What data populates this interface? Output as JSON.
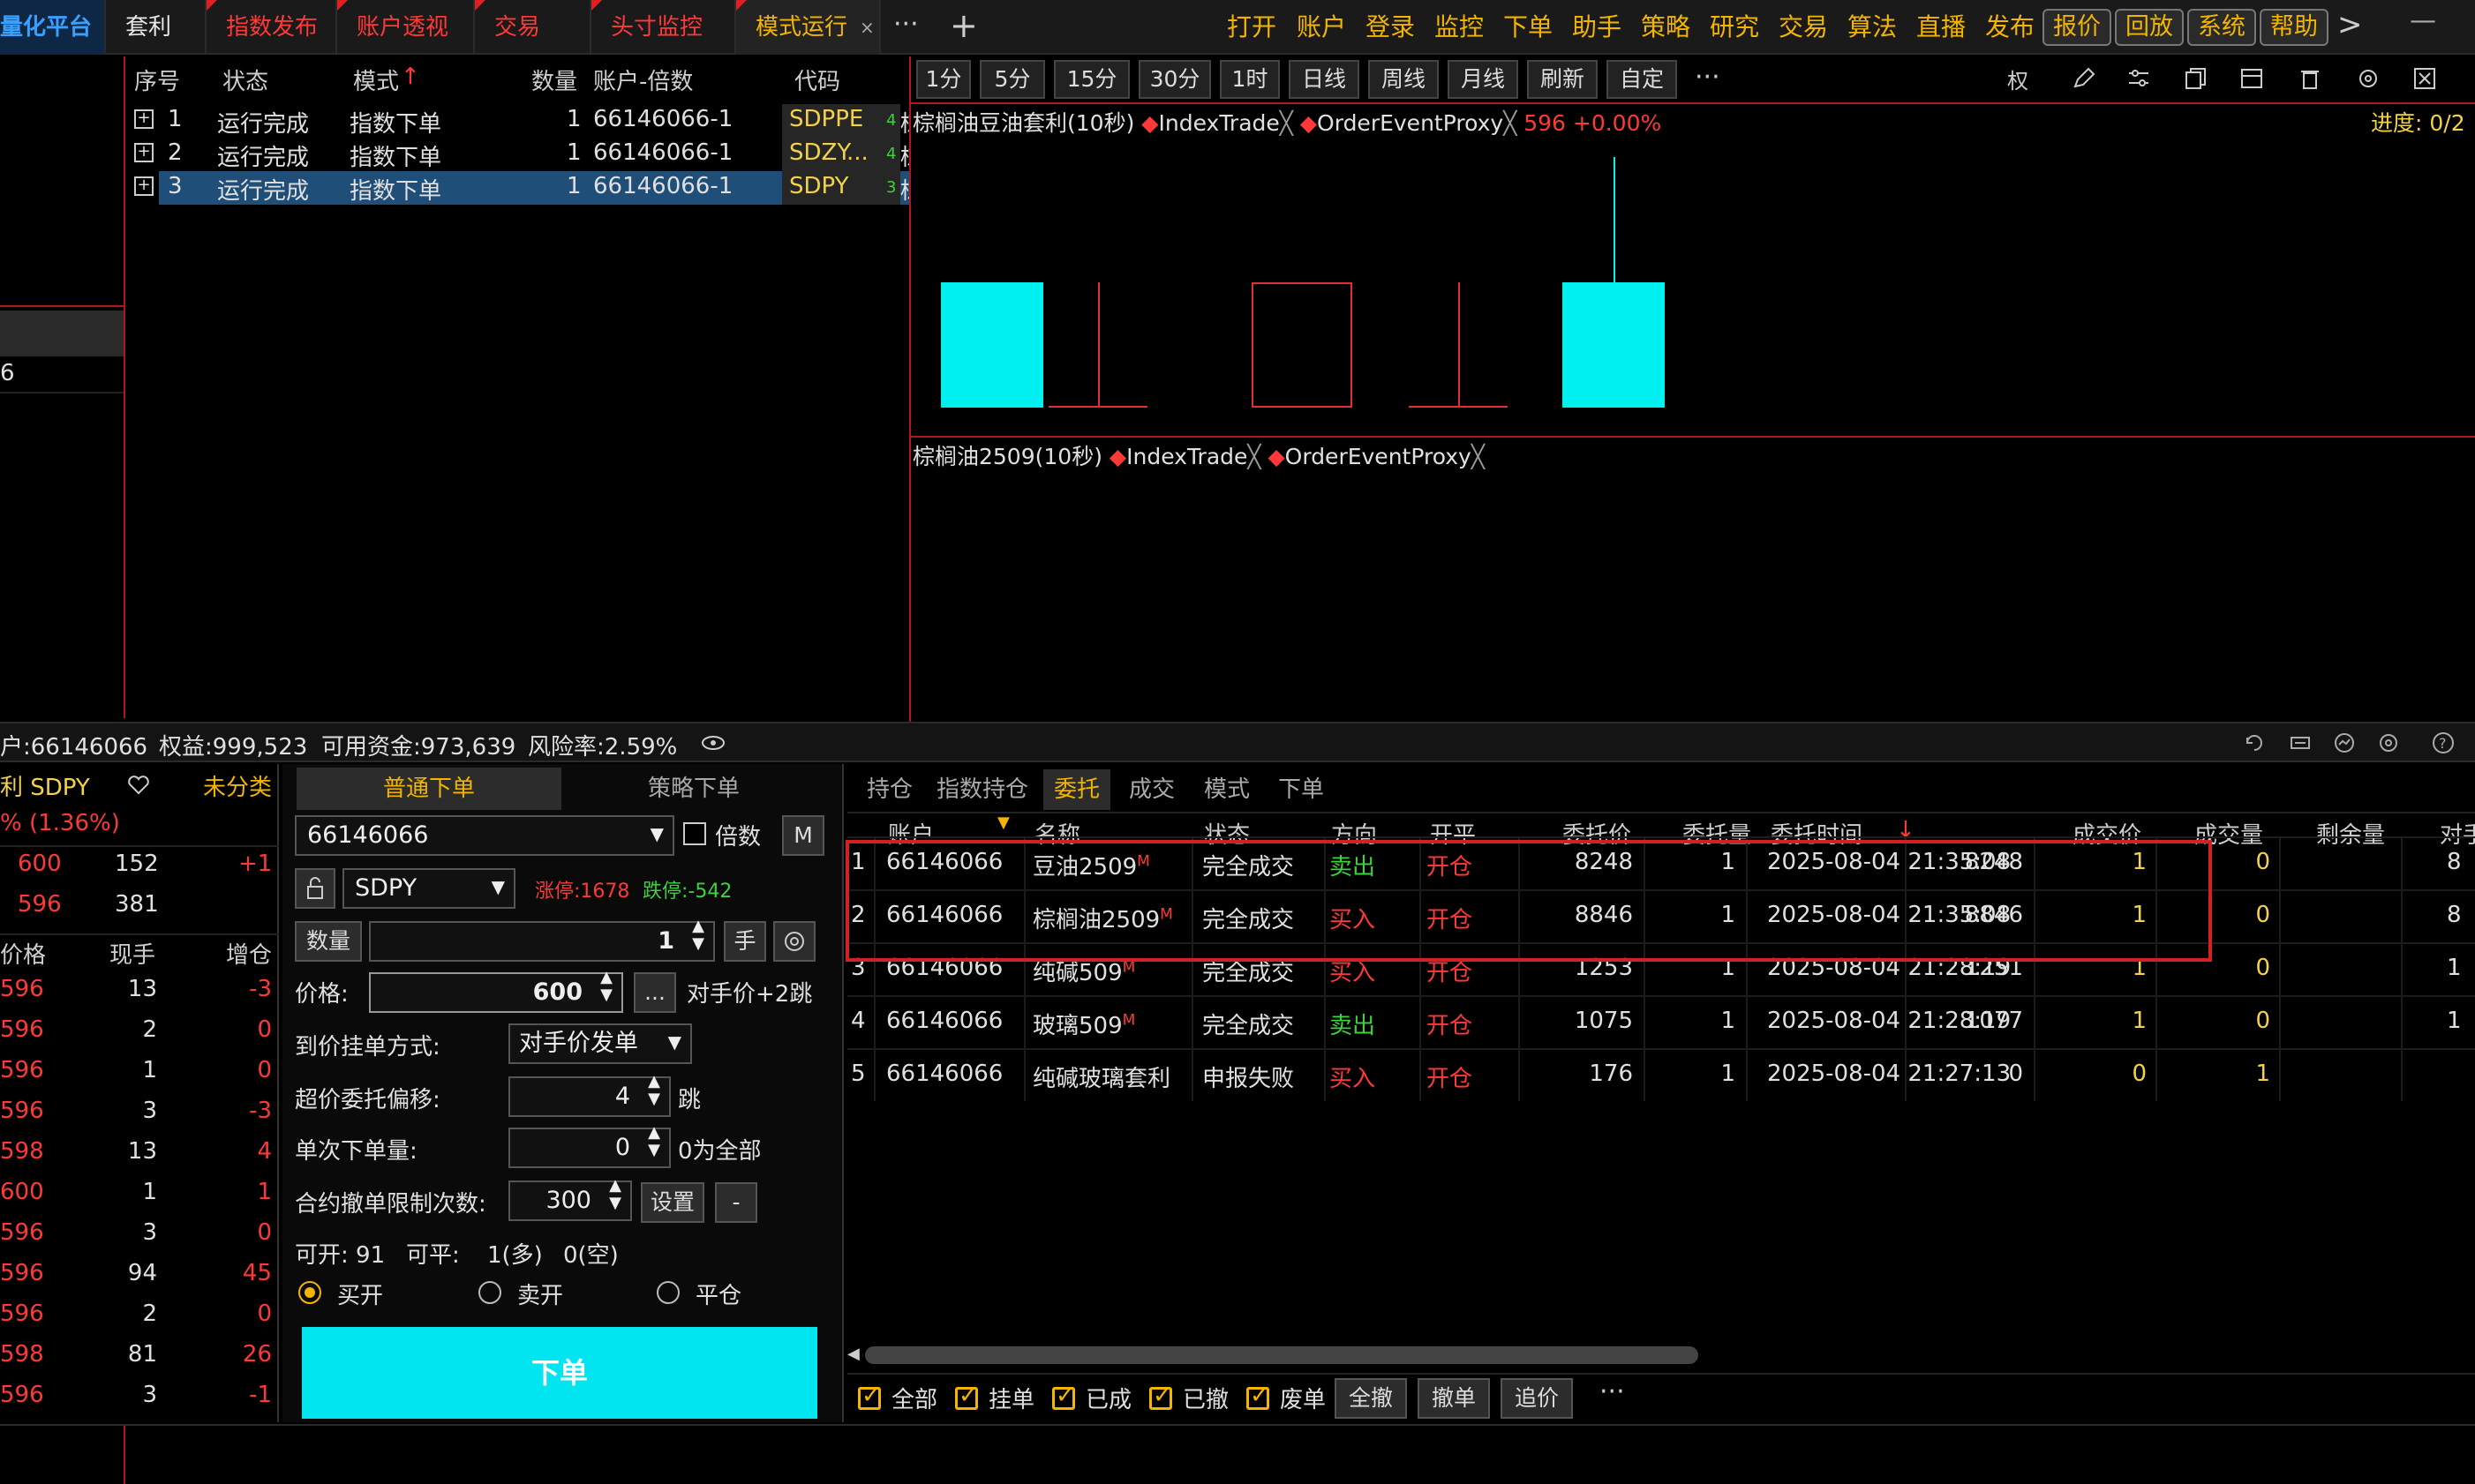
{
  "tabs": [
    {
      "label": "量化平台"
    },
    {
      "label": "套利"
    },
    {
      "label": "指数发布"
    },
    {
      "label": "账户透视"
    },
    {
      "label": "交易"
    },
    {
      "label": "头寸监控"
    },
    {
      "label": "模式运行"
    }
  ],
  "tab_more": "···",
  "tab_add": "+",
  "tab_close": "×",
  "menu": [
    "打开",
    "账户",
    "登录",
    "监控",
    "下单",
    "助手",
    "策略",
    "研究",
    "交易",
    "算法",
    "直播",
    "发布"
  ],
  "menu_buttons": [
    "报价",
    "回放",
    "系统",
    "帮助"
  ],
  "window_min": "—",
  "menu_more": ">",
  "mode_table": {
    "headers": [
      "序号",
      "状态",
      "模式",
      "数量",
      "账户-倍数",
      "代码"
    ],
    "rows": [
      {
        "no": "1",
        "status": "运行完成",
        "mode": "指数下单",
        "qty": "1",
        "acct": "66146066-1",
        "code": "SDPPE",
        "extra": "4",
        "tail": "棕"
      },
      {
        "no": "2",
        "status": "运行完成",
        "mode": "指数下单",
        "qty": "1",
        "acct": "66146066-1",
        "code": "SDZY...",
        "extra": "4",
        "tail": "棕"
      },
      {
        "no": "3",
        "status": "运行完成",
        "mode": "指数下单",
        "qty": "1",
        "acct": "66146066-1",
        "code": "SDPY",
        "extra": "3",
        "tail": "棕"
      }
    ]
  },
  "left_stub": {
    "num": "6"
  },
  "chart_toolbar": [
    "1分",
    "5分",
    "15分",
    "30分",
    "1时",
    "日线",
    "周线",
    "月线",
    "刷新",
    "自定"
  ],
  "chart_toolbar_more": "···",
  "chart_toolbar_icons": {
    "quan": "权"
  },
  "chart1": {
    "title": "棕榈油豆油套利(10秒)",
    "ind1": "IndexTrade",
    "ind2": "OrderEventProxy",
    "value": "596 +0.00%",
    "progress": "进度: 0/2"
  },
  "chart2": {
    "title": "棕榈油2509(10秒)",
    "ind1": "IndexTrade",
    "ind2": "OrderEventProxy"
  },
  "status_bar": {
    "account": "户:66146066",
    "equity": "权益:999,523",
    "available": "可用资金:973,639",
    "risk": "风险率:2.59%"
  },
  "quote_panel": {
    "title": "利 SDPY",
    "category": "未分类",
    "change": "% (1.36%)",
    "bid_rows": [
      {
        "p": "600",
        "v": "152",
        "d": "+1"
      },
      {
        "p": "596",
        "v": "381",
        "d": ""
      }
    ],
    "headers": [
      "价格",
      "现手",
      "增仓"
    ],
    "ticks": [
      {
        "p": "596",
        "v": "13",
        "d": "-3"
      },
      {
        "p": "596",
        "v": "2",
        "d": "0"
      },
      {
        "p": "596",
        "v": "1",
        "d": "0"
      },
      {
        "p": "596",
        "v": "3",
        "d": "-3"
      },
      {
        "p": "598",
        "v": "13",
        "d": "4"
      },
      {
        "p": "600",
        "v": "1",
        "d": "1"
      },
      {
        "p": "596",
        "v": "3",
        "d": "0"
      },
      {
        "p": "596",
        "v": "94",
        "d": "45"
      },
      {
        "p": "596",
        "v": "2",
        "d": "0"
      },
      {
        "p": "598",
        "v": "81",
        "d": "26"
      },
      {
        "p": "596",
        "v": "3",
        "d": "-1"
      }
    ]
  },
  "order_form": {
    "tab_normal": "普通下单",
    "tab_strategy": "策略下单",
    "account": "66146066",
    "multiple_label": "倍数",
    "m_button": "M",
    "symbol": "SDPY",
    "limit_up": "涨停:1678",
    "limit_down": "跌停:-542",
    "qty_button": "数量",
    "qty": "1",
    "hand": "手",
    "price_label": "价格:",
    "price": "600",
    "price_more": "...",
    "price_desc": "对手价+2跳",
    "pending_label": "到价挂单方式:",
    "pending_value": "对手价发单",
    "offset_label": "超价委托偏移:",
    "offset_value": "4",
    "offset_unit": "跳",
    "single_label": "单次下单量:",
    "single_value": "0",
    "single_unit": "0为全部",
    "cancel_label": "合约撤单限制次数:",
    "cancel_value": "300",
    "set_button": "设置",
    "minus_button": "-",
    "open_avail": "可开:  91",
    "close_avail": "可平:",
    "close_long": "1(多)",
    "close_short": "0(空)",
    "radio_buy": "买开",
    "radio_sell": "卖开",
    "radio_close": "平仓",
    "submit": "下单"
  },
  "orders": {
    "tabs": [
      "持仓",
      "指数持仓",
      "委托",
      "成交",
      "模式",
      "下单"
    ],
    "headers": [
      "账户",
      "名称",
      "状态",
      "方向",
      "开平",
      "委托价",
      "委托量",
      "委托时间",
      "成交价",
      "成交量",
      "剩余量",
      "对手"
    ],
    "rows": [
      {
        "no": "1",
        "acct": "66146066",
        "name": "豆油2509",
        "m": "M",
        "status": "完全成交",
        "dir": "卖出",
        "oc": "开仓",
        "price": "8248",
        "qty": "1",
        "time": "2025-08-04 21:35:08",
        "fill": "8248",
        "fqty": "1",
        "rem": "0",
        "x": "8"
      },
      {
        "no": "2",
        "acct": "66146066",
        "name": "棕榈油2509",
        "m": "M",
        "status": "完全成交",
        "dir": "买入",
        "oc": "开仓",
        "price": "8846",
        "qty": "1",
        "time": "2025-08-04 21:35:08",
        "fill": "8846",
        "fqty": "1",
        "rem": "0",
        "x": "8"
      },
      {
        "no": "3",
        "acct": "66146066",
        "name": "纯碱509",
        "m": "M",
        "status": "完全成交",
        "dir": "买入",
        "oc": "开仓",
        "price": "1253",
        "qty": "1",
        "time": "2025-08-04 21:28:19",
        "fill": "1251",
        "fqty": "1",
        "rem": "0",
        "x": "1"
      },
      {
        "no": "4",
        "acct": "66146066",
        "name": "玻璃509",
        "m": "M",
        "status": "完全成交",
        "dir": "卖出",
        "oc": "开仓",
        "price": "1075",
        "qty": "1",
        "time": "2025-08-04 21:28:19",
        "fill": "1077",
        "fqty": "1",
        "rem": "0",
        "x": "1"
      },
      {
        "no": "5",
        "acct": "66146066",
        "name": "纯碱玻璃套利",
        "m": "",
        "status": "申报失败",
        "dir": "买入",
        "oc": "开仓",
        "price": "176",
        "qty": "1",
        "time": "2025-08-04 21:27:13",
        "fill": "0",
        "fqty": "0",
        "rem": "1",
        "x": ""
      }
    ],
    "filters": [
      "全部",
      "挂单",
      "已成",
      "已撤",
      "废单"
    ],
    "buttons": [
      "全撤",
      "撤单",
      "追价"
    ],
    "more": "···"
  },
  "colors": {
    "accent": "#f3b500",
    "up": "#ff3838",
    "down": "#3bd43b",
    "candle": "#00e5e5",
    "highlight": "#d42020"
  }
}
